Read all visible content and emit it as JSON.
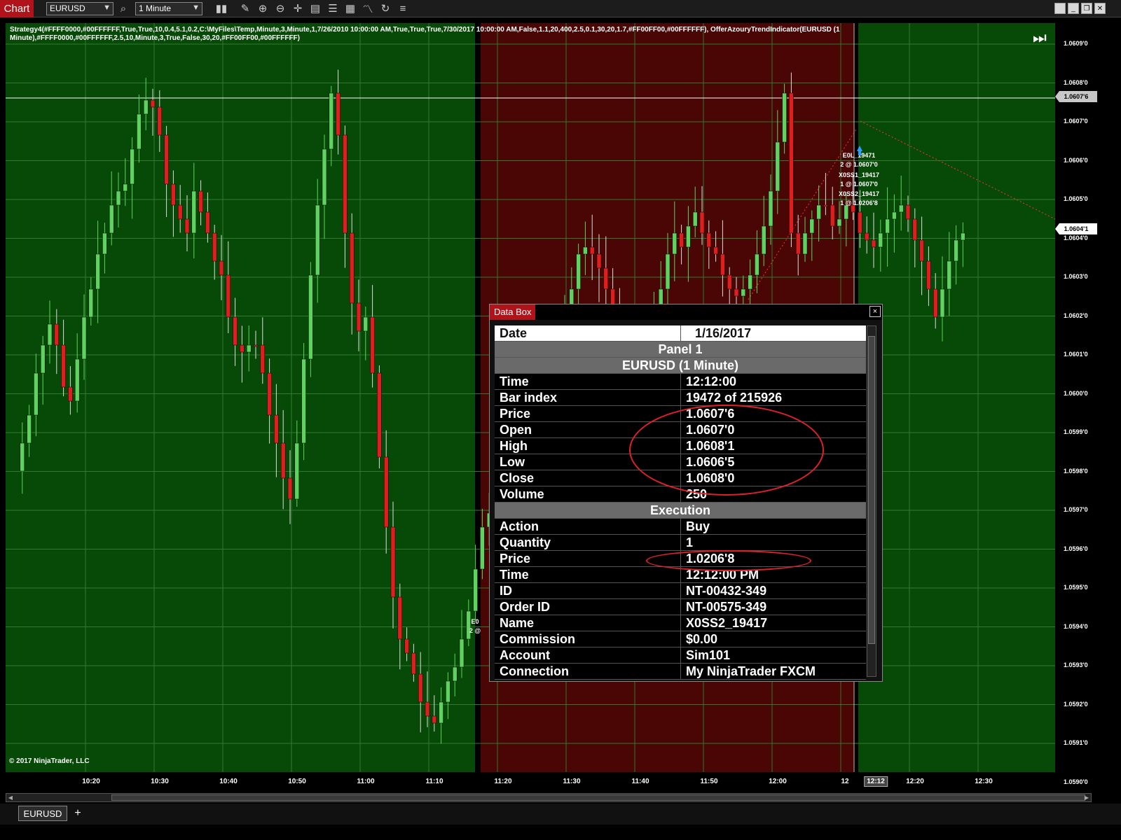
{
  "toolbar": {
    "chart_tab": "Chart",
    "instrument": "EURUSD",
    "interval": "1 Minute"
  },
  "chart": {
    "strategy_label": "Strategy4(#FFFF0000,#00FFFFFF,True,True,10,0.4,5.1,0.2,C:\\MyFiles\\Temp,Minute,3,Minute,1,7/26/2010 10:00:00 AM,True,True,True,7/30/2017 10:00:00 AM,False,1.1,20,400,2.5,0.1,30,20,1.7,#FF00FF00,#00FFFFFF), OfferAzouryTrendIndicator(EURUSD (1 Minute),#FFFF0000,#00FFFFFF,2.5,10,Minute,3,True,False,30,20,#FF00FF00,#00FFFFFF)",
    "copyright": "© 2017 NinjaTrader, LLC",
    "colors": {
      "bull": "#5fd35f",
      "bear": "#e01e1e",
      "bg_green": "#074a07",
      "bg_red": "#4a0505",
      "grid": "#2f7a2f"
    },
    "price_ticks": [
      "1.0609'0",
      "1.0608'0",
      "1.0607'0",
      "1.0606'0",
      "1.0605'0",
      "1.0604'0",
      "1.0603'0",
      "1.0602'0",
      "1.0601'0",
      "1.0600'0",
      "1.0599'0",
      "1.0598'0",
      "1.0597'0",
      "1.0596'0",
      "1.0595'0",
      "1.0594'0",
      "1.0593'0",
      "1.0592'0",
      "1.0591'0",
      "1.0590'0"
    ],
    "price_marker_upper": "1.0607'6",
    "price_marker_lower": "1.0604'1",
    "time_ticks": [
      "10:20",
      "10:30",
      "10:40",
      "10:50",
      "11:00",
      "11:10",
      "11:20",
      "11:30",
      "11:40",
      "11:50",
      "12:00",
      "12",
      "12:20",
      "12:30"
    ],
    "time_highlight": "12:12",
    "annotations": [
      "E0L_19471",
      "2 @ 1.0607'0",
      "X0SS1_19417",
      "1 @ 1.0607'0",
      "X0SS2_19417",
      "1 @ 1.0206'8"
    ],
    "annotation_left": [
      "E0",
      "2 @"
    ]
  },
  "bottom_tabs": {
    "tab": "EURUSD",
    "add": "+"
  },
  "databox": {
    "title": "Data Box",
    "close": "×",
    "date_label": "Date",
    "date_value": "1/16/2017",
    "panel_header": "Panel 1",
    "series_header": "EURUSD (1 Minute)",
    "bar_rows": [
      {
        "k": "Time",
        "v": "12:12:00"
      },
      {
        "k": "Bar index",
        "v": "19472 of 215926"
      },
      {
        "k": "Price",
        "v": "1.0607'6"
      },
      {
        "k": "Open",
        "v": "1.0607'0"
      },
      {
        "k": "High",
        "v": "1.0608'1"
      },
      {
        "k": "Low",
        "v": "1.0606'5"
      },
      {
        "k": "Close",
        "v": "1.0608'0"
      },
      {
        "k": "Volume",
        "v": "250"
      }
    ],
    "exec_header": "Execution",
    "exec_rows": [
      {
        "k": "Action",
        "v": "Buy"
      },
      {
        "k": "Quantity",
        "v": "1"
      },
      {
        "k": "Price",
        "v": "1.0206'8"
      },
      {
        "k": "Time",
        "v": "12:12:00 PM"
      },
      {
        "k": "ID",
        "v": "NT-00432-349"
      },
      {
        "k": "Order ID",
        "v": "NT-00575-349"
      },
      {
        "k": "Name",
        "v": "X0SS2_19417"
      },
      {
        "k": "Commission",
        "v": "$0.00"
      },
      {
        "k": "Account",
        "v": "Sim101"
      },
      {
        "k": "Connection",
        "v": "My NinjaTrader FXCM"
      }
    ]
  }
}
